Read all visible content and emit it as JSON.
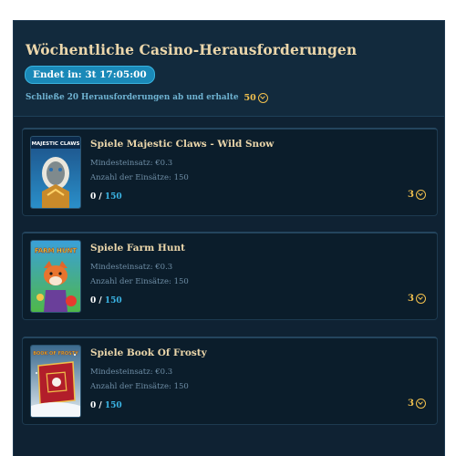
{
  "header": {
    "title": "Wöchentliche Casino-Herausforderungen",
    "timer": "Endet in: 3t 17:05:00",
    "reward_text": "Schließe 20 Herausforderungen ab und erhalte",
    "reward_amount": "50",
    "reward_icon": "coin-icon"
  },
  "challenges": [
    {
      "title": "Spiele Majestic Claws - Wild Snow",
      "thumb_label": "MAJESTIC CLAWS",
      "min_bet": "Mindesteinsatz: €0.3",
      "bet_count": "Anzahl der Einsätze: 150",
      "progress_current": "0",
      "progress_sep": "/",
      "progress_total": "150",
      "reward": "3",
      "accent": "#3b79b8"
    },
    {
      "title": "Spiele Farm Hunt",
      "thumb_label": "FARM HUNT",
      "min_bet": "Mindesteinsatz: €0.3",
      "bet_count": "Anzahl der Einsätze: 150",
      "progress_current": "0",
      "progress_sep": "/",
      "progress_total": "150",
      "reward": "3",
      "accent": "#2f8d3c"
    },
    {
      "title": "Spiele Book Of Frosty",
      "thumb_label": "BOOK OF FROSTY",
      "min_bet": "Mindesteinsatz: €0.3",
      "bet_count": "Anzahl der Einsätze: 150",
      "progress_current": "0",
      "progress_sep": "/",
      "progress_total": "150",
      "reward": "3",
      "accent": "#a8202a"
    }
  ]
}
